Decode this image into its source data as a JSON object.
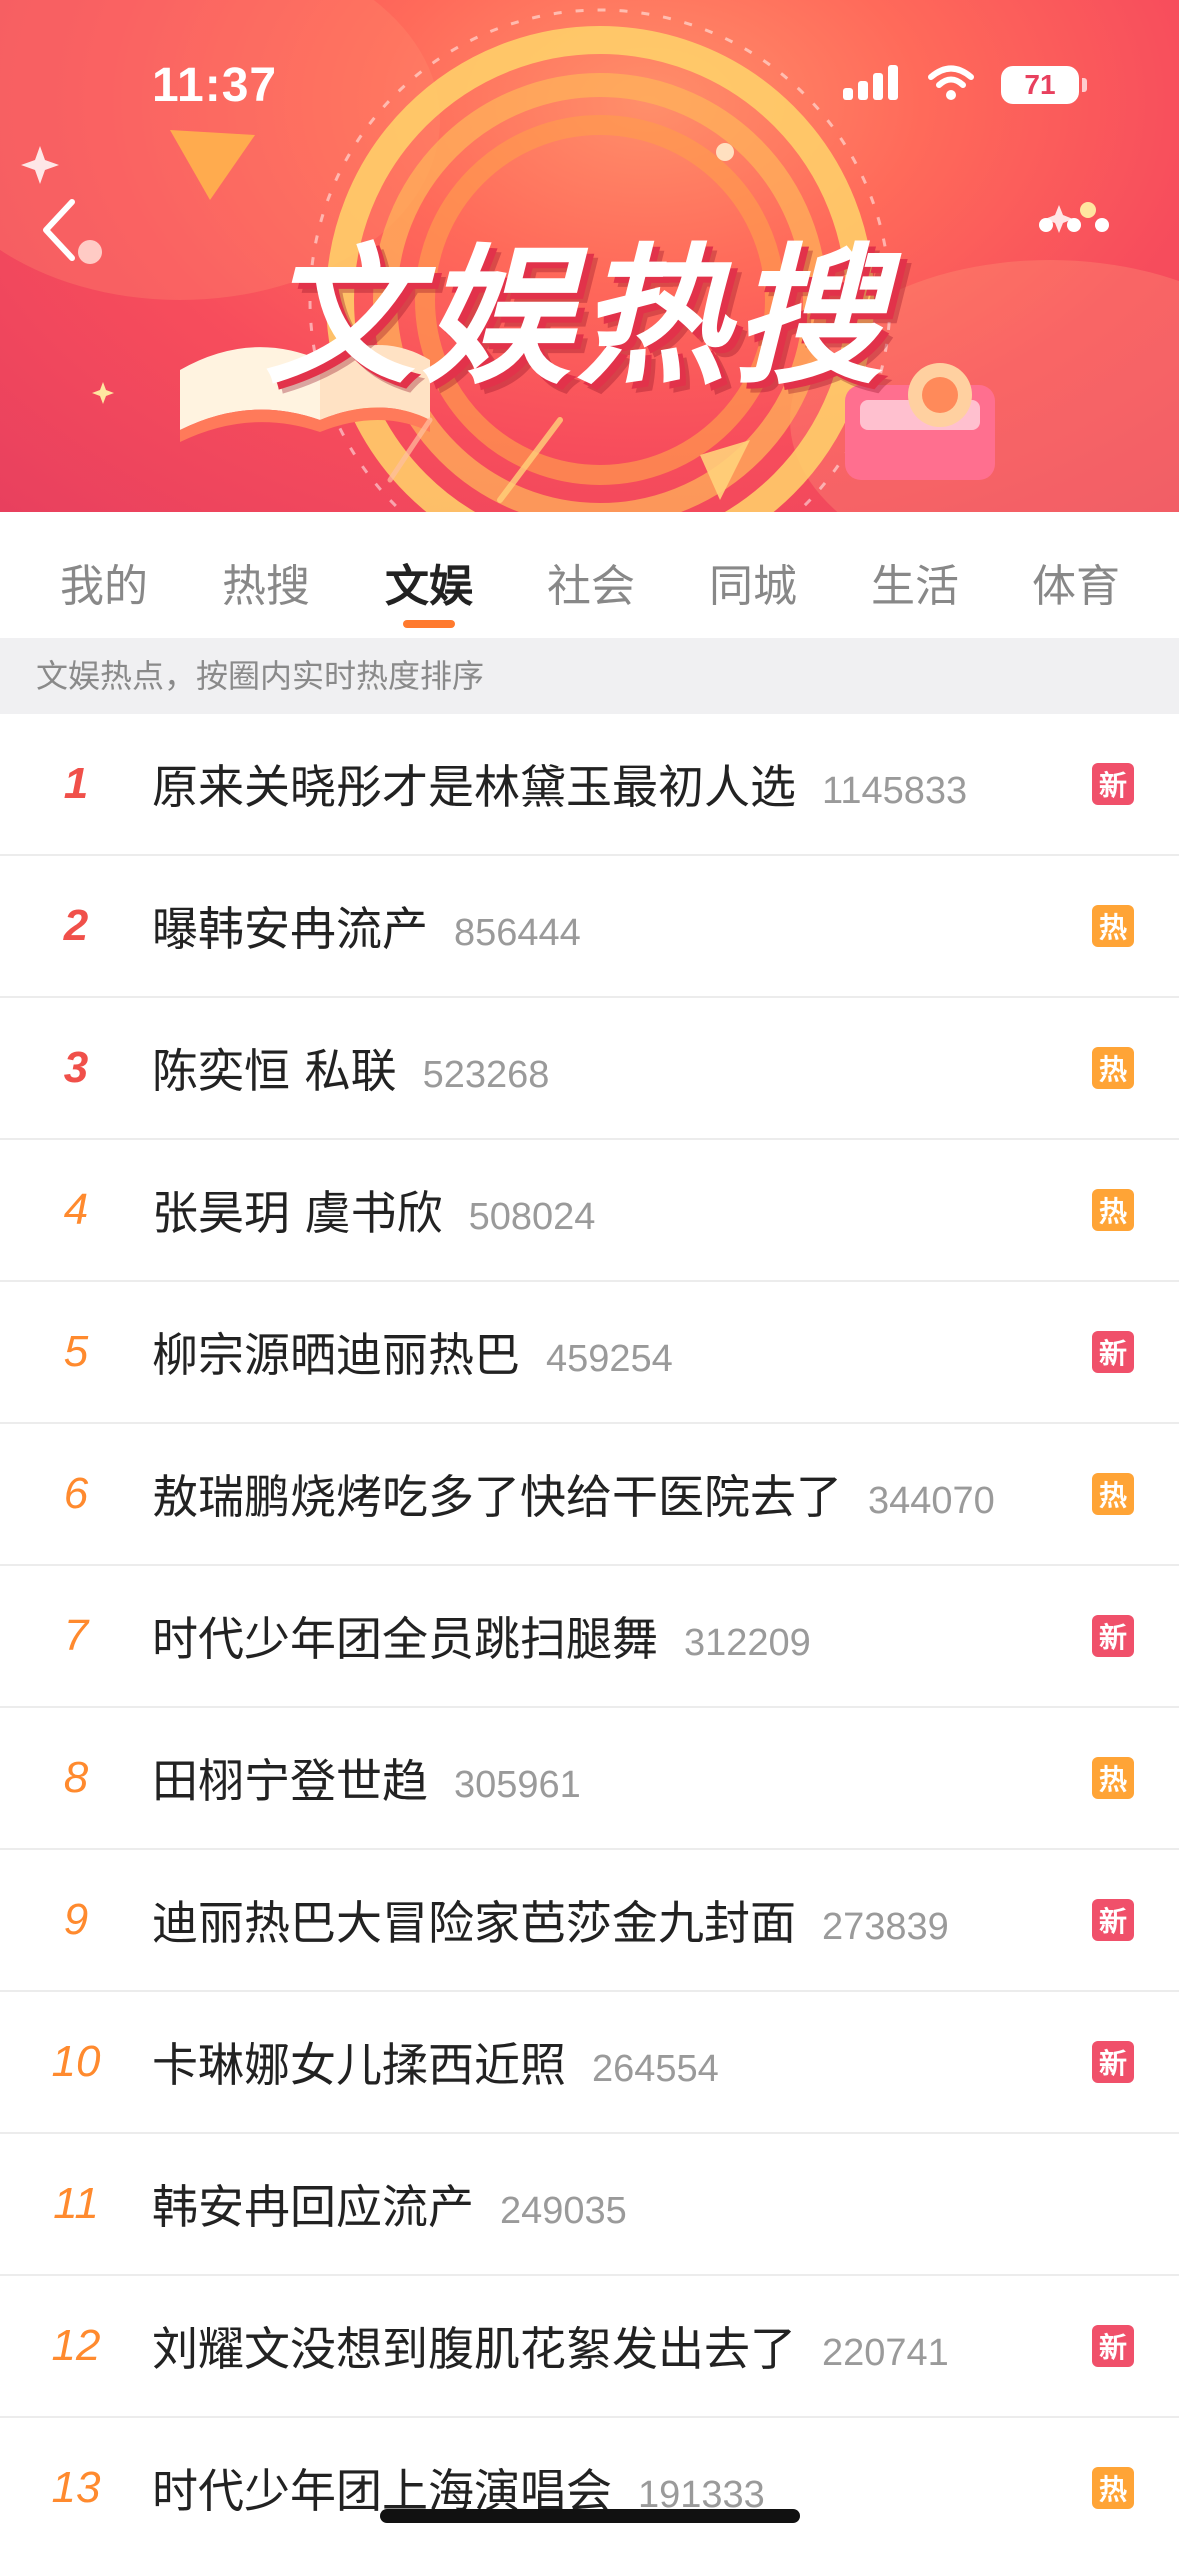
{
  "status_bar": {
    "time": "11:37",
    "battery": "71"
  },
  "header": {
    "title": "文娱热搜"
  },
  "colors": {
    "new_badge": "#f0506a",
    "hot_badge": "#ffa436",
    "accent": "#ff7a2e",
    "rank_top": "#f0504a",
    "rank_other": "#ff8a2e"
  },
  "icons": {
    "back": "chevron-left-icon",
    "more": "more-dots-icon",
    "signal": "signal-icon",
    "wifi": "wifi-icon",
    "battery": "battery-icon"
  },
  "tabs": [
    {
      "label": "我的"
    },
    {
      "label": "热搜"
    },
    {
      "label": "文娱",
      "active": true
    },
    {
      "label": "社会"
    },
    {
      "label": "同城"
    },
    {
      "label": "生活"
    },
    {
      "label": "体育"
    }
  ],
  "hint": "文娱热点，按圈内实时热度排序",
  "items": [
    {
      "rank": "1",
      "title": "原来关晓彤才是林黛玉最初人选",
      "count": "1145833",
      "badge": "新",
      "badge_type": "new"
    },
    {
      "rank": "2",
      "title": "曝韩安冉流产",
      "count": "856444",
      "badge": "热",
      "badge_type": "hot"
    },
    {
      "rank": "3",
      "title": "陈奕恒 私联",
      "count": "523268",
      "badge": "热",
      "badge_type": "hot"
    },
    {
      "rank": "4",
      "title": "张昊玥 虞书欣",
      "count": "508024",
      "badge": "热",
      "badge_type": "hot"
    },
    {
      "rank": "5",
      "title": "柳宗源晒迪丽热巴",
      "count": "459254",
      "badge": "新",
      "badge_type": "new"
    },
    {
      "rank": "6",
      "title": "敖瑞鹏烧烤吃多了快给干医院去了",
      "count": "344070",
      "badge": "热",
      "badge_type": "hot"
    },
    {
      "rank": "7",
      "title": "时代少年团全员跳扫腿舞",
      "count": "312209",
      "badge": "新",
      "badge_type": "new"
    },
    {
      "rank": "8",
      "title": "田栩宁登世趋",
      "count": "305961",
      "badge": "热",
      "badge_type": "hot"
    },
    {
      "rank": "9",
      "title": "迪丽热巴大冒险家芭莎金九封面",
      "count": "273839",
      "badge": "新",
      "badge_type": "new"
    },
    {
      "rank": "10",
      "title": "卡琳娜女儿揉西近照",
      "count": "264554",
      "badge": "新",
      "badge_type": "new"
    },
    {
      "rank": "11",
      "title": "韩安冉回应流产",
      "count": "249035",
      "badge": "",
      "badge_type": "none"
    },
    {
      "rank": "12",
      "title": "刘耀文没想到腹肌花絮发出去了",
      "count": "220741",
      "badge": "新",
      "badge_type": "new"
    },
    {
      "rank": "13",
      "title": "时代少年团上海演唱会",
      "count": "191333",
      "badge": "热",
      "badge_type": "hot"
    }
  ]
}
